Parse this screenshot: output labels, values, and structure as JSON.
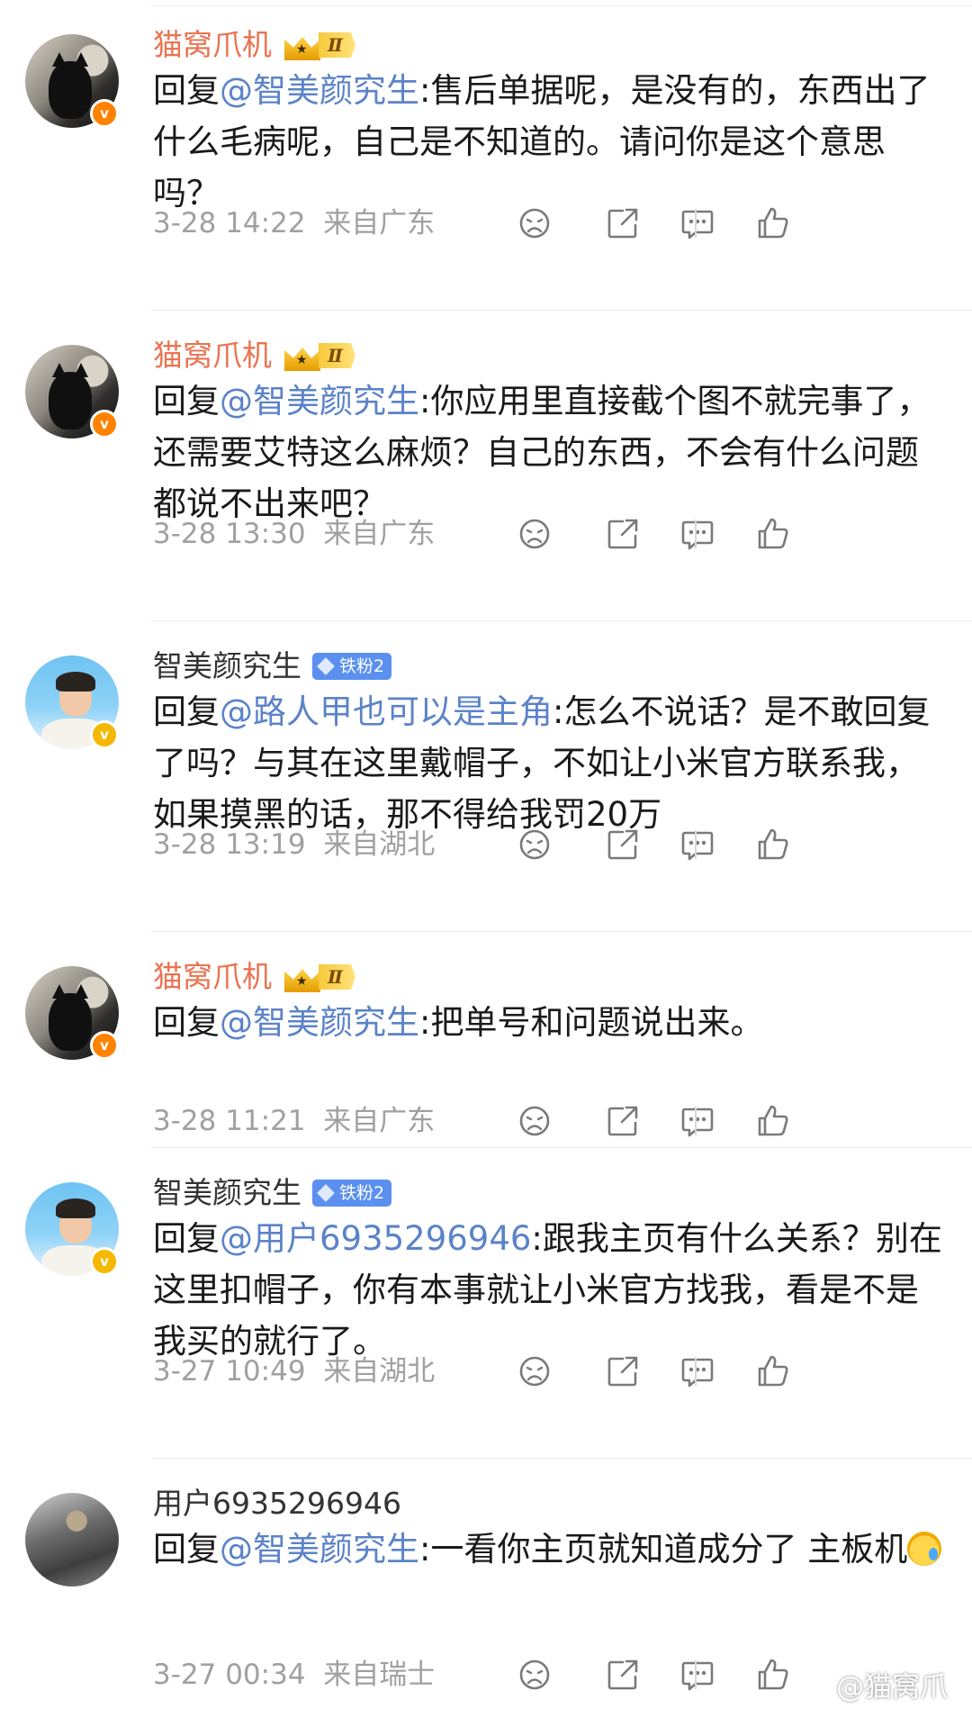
{
  "comments": [
    {
      "user": "猫窝爪机",
      "vip_level": "Ⅱ",
      "reply_prefix": "回复",
      "mention": "@智美颜究生",
      "body": ":售后单据呢，是没有的，东西出了什么毛病呢，自己是不知道的。请问你是这个意思吗？",
      "time": "3-28 14:22",
      "location": "来自广东"
    },
    {
      "user": "猫窝爪机",
      "vip_level": "Ⅱ",
      "reply_prefix": "回复",
      "mention": "@智美颜究生",
      "body": ":你应用里直接截个图不就完事了，还需要艾特这么麻烦？自己的东西，不会有什么问题都说不出来吧？",
      "time": "3-28 13:30",
      "location": "来自广东"
    },
    {
      "user": "智美颜究生",
      "fan_badge": "铁粉2",
      "reply_prefix": "回复",
      "mention": "@路人甲也可以是主角",
      "body": ":怎么不说话？是不敢回复了吗？与其在这里戴帽子，不如让小米官方联系我，如果摸黑的话，那不得给我罚20万",
      "time": "3-28 13:19",
      "location": "来自湖北"
    },
    {
      "user": "猫窝爪机",
      "vip_level": "Ⅱ",
      "reply_prefix": "回复",
      "mention": "@智美颜究生",
      "body": ":把单号和问题说出来。",
      "time": "3-28 11:21",
      "location": "来自广东"
    },
    {
      "user": "智美颜究生",
      "fan_badge": "铁粉2",
      "reply_prefix": "回复",
      "mention": "@用户6935296946",
      "body": ":跟我主页有什么关系？别在这里扣帽子，你有本事就让小米官方找我，看是不是我买的就行了。",
      "time": "3-27 10:49",
      "location": "来自湖北"
    },
    {
      "user": "用户6935296946",
      "reply_prefix": "回复",
      "mention": "@智美颜究生",
      "body": ":一看你主页就知道成分了 主板机",
      "time": "3-27 00:34",
      "location": "来自瑞士"
    }
  ],
  "watermark": "@猫窝爪机",
  "colors": {
    "vip_name": "#eb7350",
    "mention": "#5b83c8",
    "meta": "#a0a0a0",
    "fan_badge": "#5b8ff0",
    "verified_orange": "#ff8200",
    "verified_gold": "#f5b800"
  },
  "icons": [
    "dislike-icon",
    "share-icon",
    "comment-icon",
    "like-icon",
    "verified-icon",
    "crown-icon",
    "emoji-icon",
    "weibo-logo-icon"
  ]
}
